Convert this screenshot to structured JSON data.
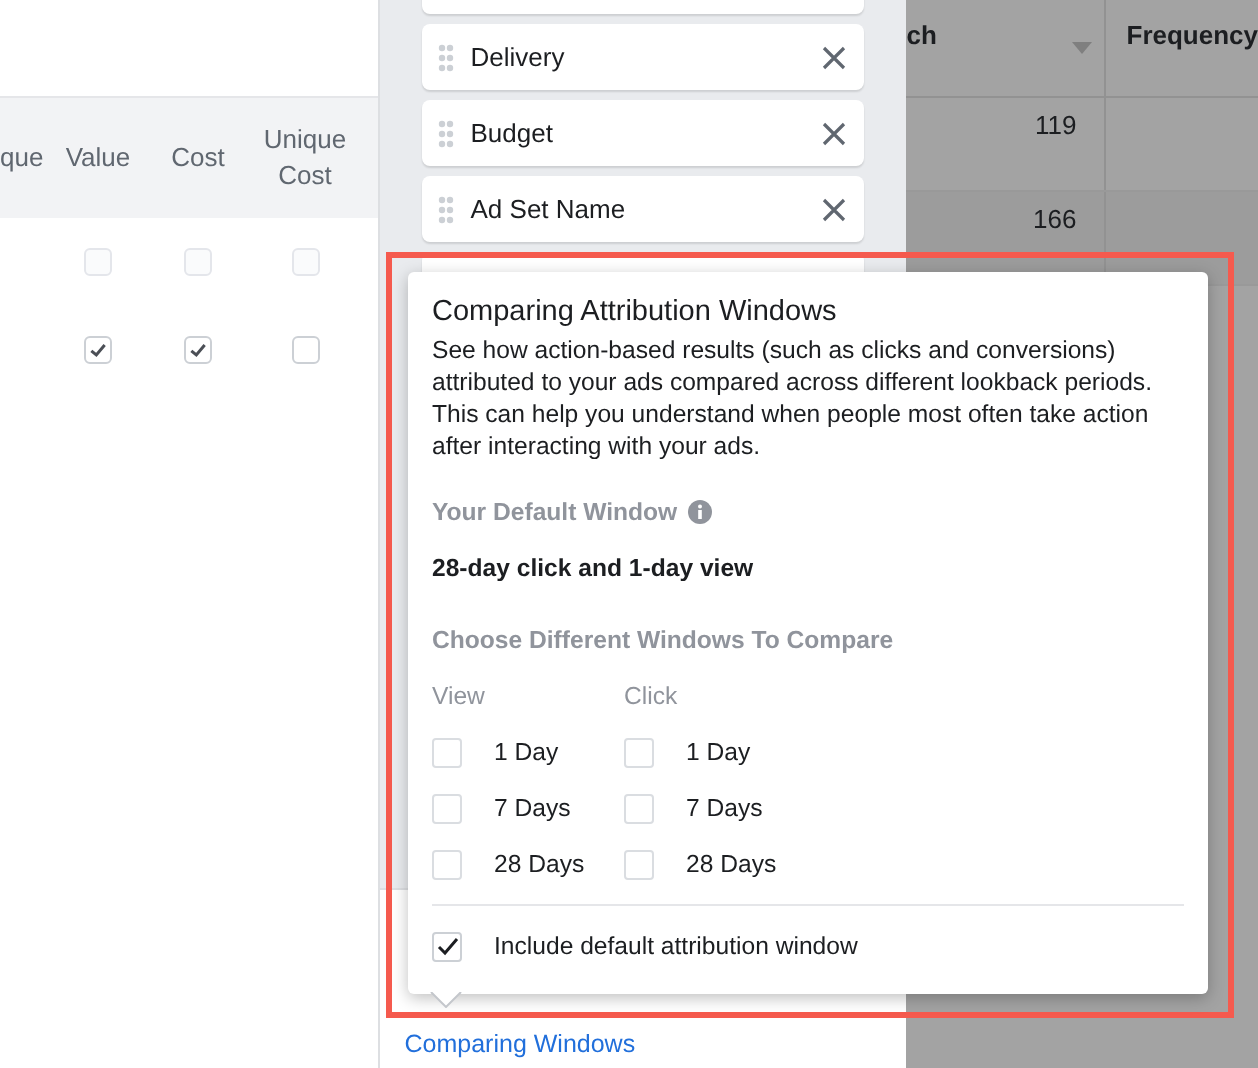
{
  "column_settings": {
    "headers": [
      "que",
      "Value",
      "Cost",
      "Unique Cost"
    ],
    "rows": [
      {
        "disabled": true,
        "checks": [
          false,
          false,
          false
        ]
      },
      {
        "disabled": false,
        "checks": [
          true,
          true,
          false
        ]
      }
    ]
  },
  "selected_columns": [
    {
      "label": "Delivery"
    },
    {
      "label": "Budget"
    },
    {
      "label": "Ad Set Name"
    }
  ],
  "report_table": {
    "columns": [
      "ch",
      "Frequency"
    ],
    "rows": [
      {
        "column_1": "119"
      },
      {
        "column_1": "166"
      }
    ]
  },
  "popover": {
    "title": "Comparing Attribution Windows",
    "description": "See how action-based results (such as clicks and conversions) attributed to your ads compared across different lookback periods. This can help you understand when people most often take action after interacting with your ads.",
    "default_window_label": "Your Default Window",
    "default_window_value": "28-day click and 1-day view",
    "compare_label": "Choose Different Windows To Compare",
    "groups": [
      {
        "label": "View",
        "options": [
          {
            "label": "1 Day",
            "checked": false
          },
          {
            "label": "7 Days",
            "checked": false
          },
          {
            "label": "28 Days",
            "checked": false
          }
        ]
      },
      {
        "label": "Click",
        "options": [
          {
            "label": "1 Day",
            "checked": false
          },
          {
            "label": "7 Days",
            "checked": false
          },
          {
            "label": "28 Days",
            "checked": false
          }
        ]
      }
    ],
    "include_default": {
      "label": "Include default attribution window",
      "checked": true
    }
  },
  "link": "Comparing Windows"
}
